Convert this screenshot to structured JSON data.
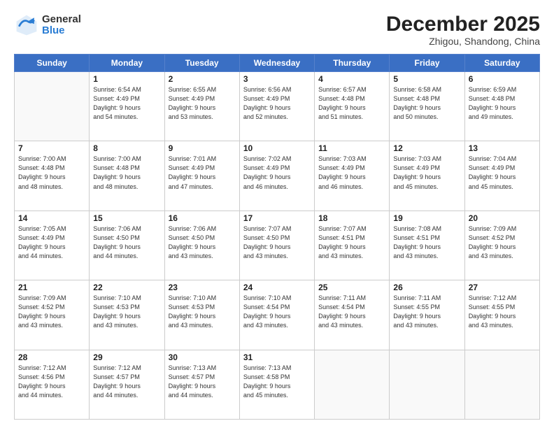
{
  "logo": {
    "general": "General",
    "blue": "Blue"
  },
  "header": {
    "month": "December 2025",
    "location": "Zhigou, Shandong, China"
  },
  "weekdays": [
    "Sunday",
    "Monday",
    "Tuesday",
    "Wednesday",
    "Thursday",
    "Friday",
    "Saturday"
  ],
  "weeks": [
    [
      {
        "day": "",
        "info": ""
      },
      {
        "day": "1",
        "info": "Sunrise: 6:54 AM\nSunset: 4:49 PM\nDaylight: 9 hours\nand 54 minutes."
      },
      {
        "day": "2",
        "info": "Sunrise: 6:55 AM\nSunset: 4:49 PM\nDaylight: 9 hours\nand 53 minutes."
      },
      {
        "day": "3",
        "info": "Sunrise: 6:56 AM\nSunset: 4:49 PM\nDaylight: 9 hours\nand 52 minutes."
      },
      {
        "day": "4",
        "info": "Sunrise: 6:57 AM\nSunset: 4:48 PM\nDaylight: 9 hours\nand 51 minutes."
      },
      {
        "day": "5",
        "info": "Sunrise: 6:58 AM\nSunset: 4:48 PM\nDaylight: 9 hours\nand 50 minutes."
      },
      {
        "day": "6",
        "info": "Sunrise: 6:59 AM\nSunset: 4:48 PM\nDaylight: 9 hours\nand 49 minutes."
      }
    ],
    [
      {
        "day": "7",
        "info": "Sunrise: 7:00 AM\nSunset: 4:48 PM\nDaylight: 9 hours\nand 48 minutes."
      },
      {
        "day": "8",
        "info": "Sunrise: 7:00 AM\nSunset: 4:48 PM\nDaylight: 9 hours\nand 48 minutes."
      },
      {
        "day": "9",
        "info": "Sunrise: 7:01 AM\nSunset: 4:49 PM\nDaylight: 9 hours\nand 47 minutes."
      },
      {
        "day": "10",
        "info": "Sunrise: 7:02 AM\nSunset: 4:49 PM\nDaylight: 9 hours\nand 46 minutes."
      },
      {
        "day": "11",
        "info": "Sunrise: 7:03 AM\nSunset: 4:49 PM\nDaylight: 9 hours\nand 46 minutes."
      },
      {
        "day": "12",
        "info": "Sunrise: 7:03 AM\nSunset: 4:49 PM\nDaylight: 9 hours\nand 45 minutes."
      },
      {
        "day": "13",
        "info": "Sunrise: 7:04 AM\nSunset: 4:49 PM\nDaylight: 9 hours\nand 45 minutes."
      }
    ],
    [
      {
        "day": "14",
        "info": "Sunrise: 7:05 AM\nSunset: 4:49 PM\nDaylight: 9 hours\nand 44 minutes."
      },
      {
        "day": "15",
        "info": "Sunrise: 7:06 AM\nSunset: 4:50 PM\nDaylight: 9 hours\nand 44 minutes."
      },
      {
        "day": "16",
        "info": "Sunrise: 7:06 AM\nSunset: 4:50 PM\nDaylight: 9 hours\nand 43 minutes."
      },
      {
        "day": "17",
        "info": "Sunrise: 7:07 AM\nSunset: 4:50 PM\nDaylight: 9 hours\nand 43 minutes."
      },
      {
        "day": "18",
        "info": "Sunrise: 7:07 AM\nSunset: 4:51 PM\nDaylight: 9 hours\nand 43 minutes."
      },
      {
        "day": "19",
        "info": "Sunrise: 7:08 AM\nSunset: 4:51 PM\nDaylight: 9 hours\nand 43 minutes."
      },
      {
        "day": "20",
        "info": "Sunrise: 7:09 AM\nSunset: 4:52 PM\nDaylight: 9 hours\nand 43 minutes."
      }
    ],
    [
      {
        "day": "21",
        "info": "Sunrise: 7:09 AM\nSunset: 4:52 PM\nDaylight: 9 hours\nand 43 minutes."
      },
      {
        "day": "22",
        "info": "Sunrise: 7:10 AM\nSunset: 4:53 PM\nDaylight: 9 hours\nand 43 minutes."
      },
      {
        "day": "23",
        "info": "Sunrise: 7:10 AM\nSunset: 4:53 PM\nDaylight: 9 hours\nand 43 minutes."
      },
      {
        "day": "24",
        "info": "Sunrise: 7:10 AM\nSunset: 4:54 PM\nDaylight: 9 hours\nand 43 minutes."
      },
      {
        "day": "25",
        "info": "Sunrise: 7:11 AM\nSunset: 4:54 PM\nDaylight: 9 hours\nand 43 minutes."
      },
      {
        "day": "26",
        "info": "Sunrise: 7:11 AM\nSunset: 4:55 PM\nDaylight: 9 hours\nand 43 minutes."
      },
      {
        "day": "27",
        "info": "Sunrise: 7:12 AM\nSunset: 4:55 PM\nDaylight: 9 hours\nand 43 minutes."
      }
    ],
    [
      {
        "day": "28",
        "info": "Sunrise: 7:12 AM\nSunset: 4:56 PM\nDaylight: 9 hours\nand 44 minutes."
      },
      {
        "day": "29",
        "info": "Sunrise: 7:12 AM\nSunset: 4:57 PM\nDaylight: 9 hours\nand 44 minutes."
      },
      {
        "day": "30",
        "info": "Sunrise: 7:13 AM\nSunset: 4:57 PM\nDaylight: 9 hours\nand 44 minutes."
      },
      {
        "day": "31",
        "info": "Sunrise: 7:13 AM\nSunset: 4:58 PM\nDaylight: 9 hours\nand 45 minutes."
      },
      {
        "day": "",
        "info": ""
      },
      {
        "day": "",
        "info": ""
      },
      {
        "day": "",
        "info": ""
      }
    ]
  ]
}
